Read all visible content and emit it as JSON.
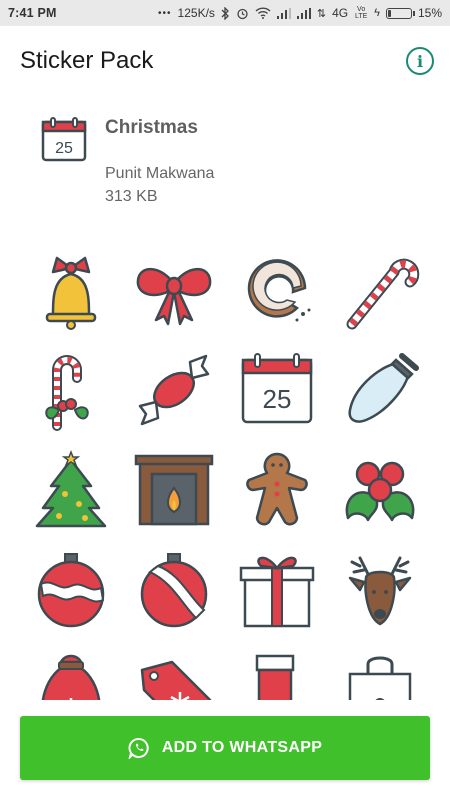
{
  "status_bar": {
    "time": "7:41 PM",
    "net_speed": "125K/s",
    "network_type": "4G",
    "volte": "Vo LTE",
    "battery": "15%"
  },
  "app_bar": {
    "title": "Sticker Pack",
    "info_icon": "info-icon"
  },
  "pack": {
    "name": "Christmas",
    "author": "Punit Makwana",
    "size": "313 KB",
    "tray_icon": "calendar-25-icon",
    "tray_day": "25"
  },
  "stickers": [
    {
      "icon": "bell-sticker"
    },
    {
      "icon": "bow-sticker"
    },
    {
      "icon": "donut-sticker"
    },
    {
      "icon": "candy-cane-sticker"
    },
    {
      "icon": "candy-cane-holly-sticker"
    },
    {
      "icon": "wrapped-candy-sticker"
    },
    {
      "icon": "calendar-25-sticker",
      "text": "25"
    },
    {
      "icon": "light-bulb-sticker"
    },
    {
      "icon": "christmas-tree-sticker"
    },
    {
      "icon": "fireplace-sticker"
    },
    {
      "icon": "gingerbread-man-sticker"
    },
    {
      "icon": "holly-berries-sticker"
    },
    {
      "icon": "ornament-sticker"
    },
    {
      "icon": "ornament-stripe-sticker"
    },
    {
      "icon": "gift-box-sticker"
    },
    {
      "icon": "reindeer-sticker"
    },
    {
      "icon": "santa-sack-sticker"
    },
    {
      "icon": "gift-tag-sticker"
    },
    {
      "icon": "stocking-sticker"
    },
    {
      "icon": "shopping-bag-sticker"
    }
  ],
  "cta": {
    "label": "ADD TO WHATSAPP",
    "icon": "whatsapp-icon",
    "color": "#40c02a"
  },
  "colors": {
    "accent": "#1a8a73",
    "red": "#e04049",
    "green": "#3fa44a",
    "gold": "#f2c33a",
    "outline": "#3d4a52"
  }
}
